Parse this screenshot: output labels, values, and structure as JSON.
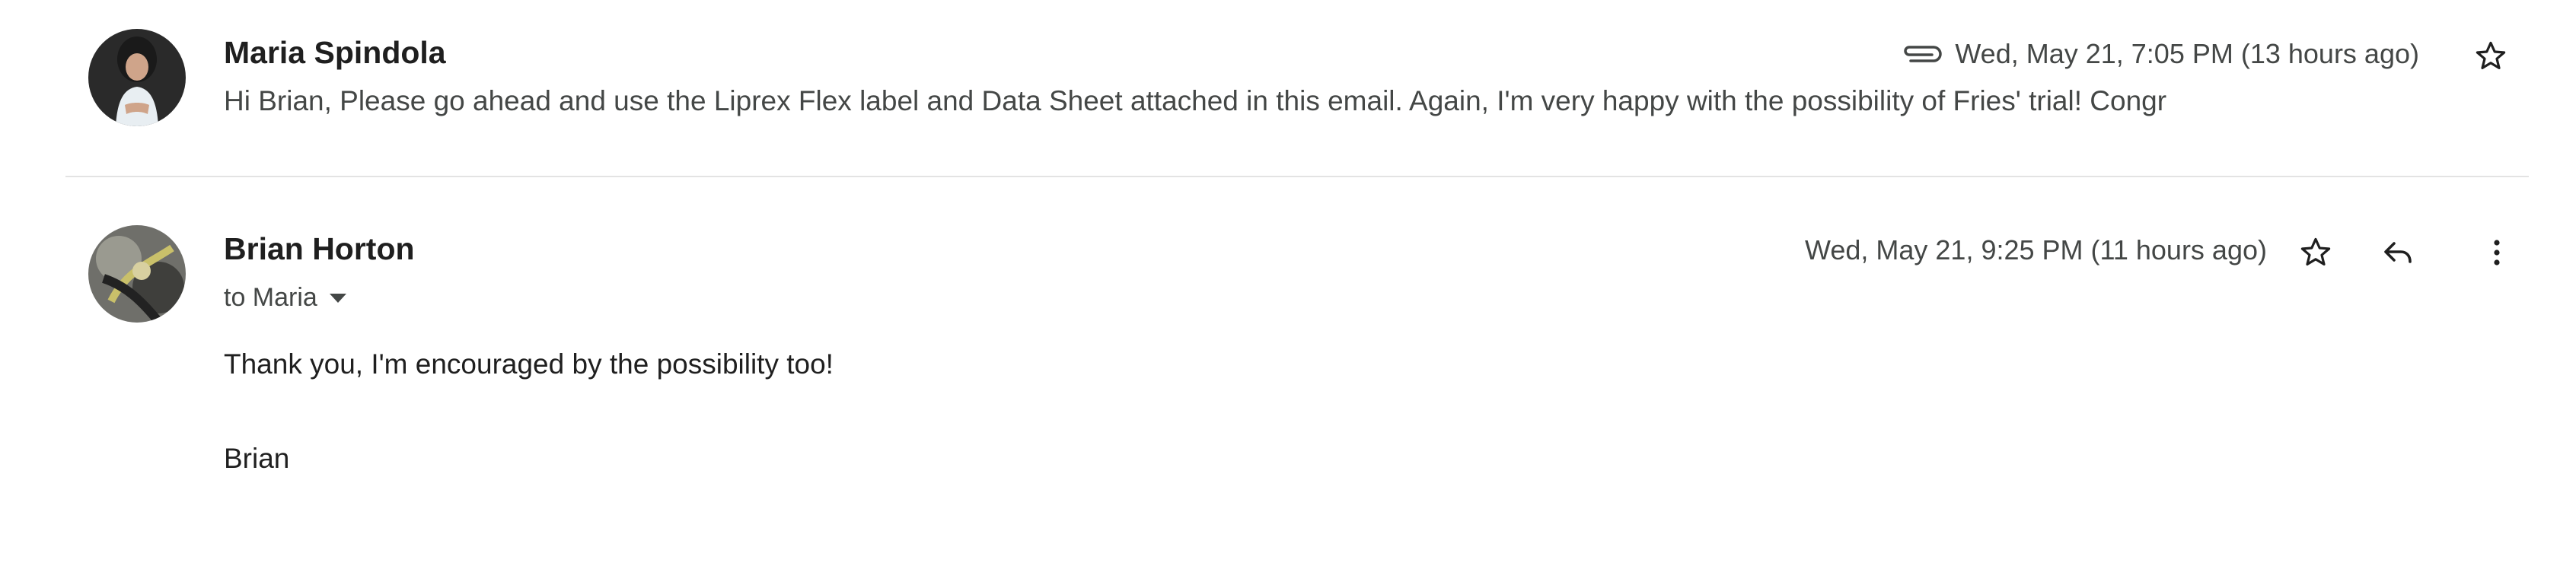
{
  "messages": [
    {
      "sender": "Maria Spindola",
      "snippet": "Hi Brian, Please go ahead and use the Liprex Flex label and Data Sheet attached in this email. Again, I'm very happy with the possibility of Fries' trial! Congr",
      "timestamp": "Wed, May 21, 7:05 PM (13 hours ago)",
      "has_attachment": true,
      "icons": [
        "attachment-icon",
        "star-icon"
      ]
    },
    {
      "sender": "Brian Horton",
      "recipient": "to Maria",
      "timestamp": "Wed, May 21, 9:25 PM (11 hours ago)",
      "body": [
        "Thank you, I'm encouraged by the possibility too!",
        "Brian"
      ],
      "icons": [
        "star-icon",
        "reply-icon",
        "more-vert-icon",
        "chevron-down-icon"
      ]
    }
  ],
  "colors": {
    "text_primary": "#1f1f1f",
    "text_secondary": "#444746",
    "divider": "#e3e3e3"
  }
}
